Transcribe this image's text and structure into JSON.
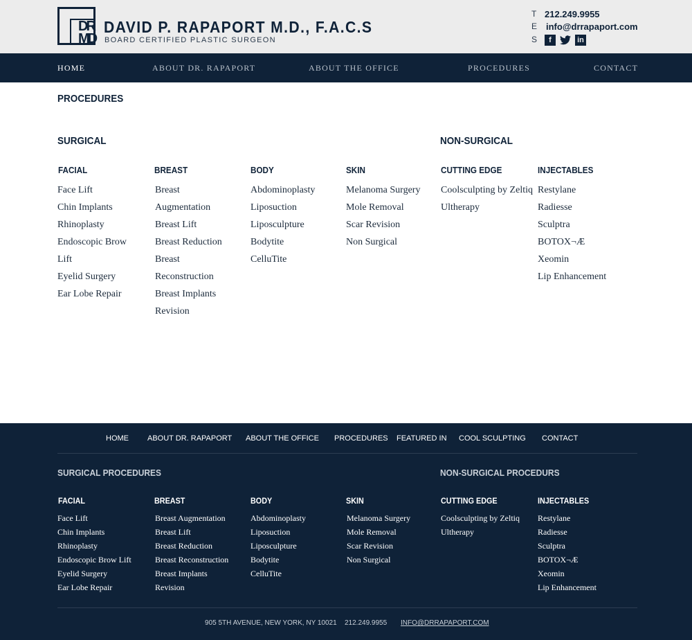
{
  "header": {
    "logo_top": "DR",
    "logo_bottom": "MD",
    "title": "DAVID P. RAPAPORT M.D., F.A.C.S",
    "subtitle": "BOARD CERTIFIED PLASTIC SURGEON",
    "contact": {
      "phone_key": "T",
      "phone": "212.249.9955",
      "email_key": "E",
      "email": "info@drrapaport.com",
      "social_key": "S",
      "social_icons": [
        "facebook-icon",
        "twitter-icon",
        "linkedin-icon"
      ]
    }
  },
  "nav": {
    "items": [
      "HOME",
      "ABOUT DR. RAPAPORT",
      "ABOUT THE OFFICE",
      "PROCEDURES",
      "CONTACT"
    ],
    "active": "HOME"
  },
  "main": {
    "title": "PROCEDURES",
    "surgical_title": "SURGICAL",
    "non_surgical_title": "NON-SURGICAL",
    "categories": [
      {
        "title": "FACIAL",
        "items": [
          "Face Lift",
          "Chin Implants",
          "Rhinoplasty",
          "Endoscopic Brow",
          "Lift",
          "Eyelid Surgery",
          "Ear Lobe Repair"
        ]
      },
      {
        "title": "BREAST",
        "items": [
          "Breast",
          "Augmentation",
          "Breast Lift",
          "Breast Reduction",
          "Breast",
          "Reconstruction",
          "Breast Implants",
          "Revision"
        ]
      },
      {
        "title": "BODY",
        "items": [
          "Abdominoplasty",
          "Liposuction",
          "Liposculpture",
          "Bodytite",
          "CelluTite"
        ]
      },
      {
        "title": "SKIN",
        "items": [
          "Melanoma Surgery",
          "Mole Removal",
          "Scar Revision",
          "Non Surgical"
        ]
      },
      {
        "title": "CUTTING EDGE",
        "items": [
          "Coolsculpting by Zeltiq",
          "Ultherapy"
        ]
      },
      {
        "title": "INJECTABLES",
        "items": [
          "Restylane",
          "Radiesse",
          "Sculptra",
          "BOTOX¬Æ",
          "Xeomin",
          "Lip Enhancement"
        ]
      }
    ]
  },
  "footer": {
    "nav": [
      "HOME",
      "ABOUT DR. RAPAPORT",
      "ABOUT THE OFFICE",
      "PROCEDURES",
      "FEATURED IN",
      "COOL SCULPTING",
      "CONTACT"
    ],
    "surgical_title": "SURGICAL PROCEDURES",
    "non_surgical_title": "NON-SURGICAL PROCEDURS",
    "categories": [
      {
        "title": "FACIAL",
        "items": [
          "Face Lift",
          "Chin Implants",
          "Rhinoplasty",
          "Endoscopic Brow Lift",
          "Eyelid Surgery",
          "Ear Lobe Repair"
        ]
      },
      {
        "title": "BREAST",
        "items": [
          "Breast Augmentation",
          "Breast Lift",
          "Breast Reduction",
          "Breast Reconstruction",
          "Breast Implants",
          "Revision"
        ]
      },
      {
        "title": "BODY",
        "items": [
          "Abdominoplasty",
          "Liposuction",
          "Liposculpture",
          "Bodytite",
          "CelluTite"
        ]
      },
      {
        "title": "SKIN",
        "items": [
          "Melanoma Surgery",
          "Mole Removal",
          "Scar Revision",
          "Non Surgical"
        ]
      },
      {
        "title": "CUTTING EDGE",
        "items": [
          "Coolsculpting by Zeltiq",
          "Ultherapy"
        ]
      },
      {
        "title": "INJECTABLES",
        "items": [
          "Restylane",
          "Radiesse",
          "Sculptra",
          "BOTOX¬Æ",
          "Xeomin",
          "Lip Enhancement"
        ]
      }
    ],
    "address": "905 5TH AVENUE, NEW YORK, NY 10021",
    "phone": "212.249.9955",
    "email": "INFO@DRRAPAPORT.COM"
  },
  "colors": {
    "navy": "#0f2238",
    "header_bg": "#ececec",
    "white": "#ffffff"
  }
}
